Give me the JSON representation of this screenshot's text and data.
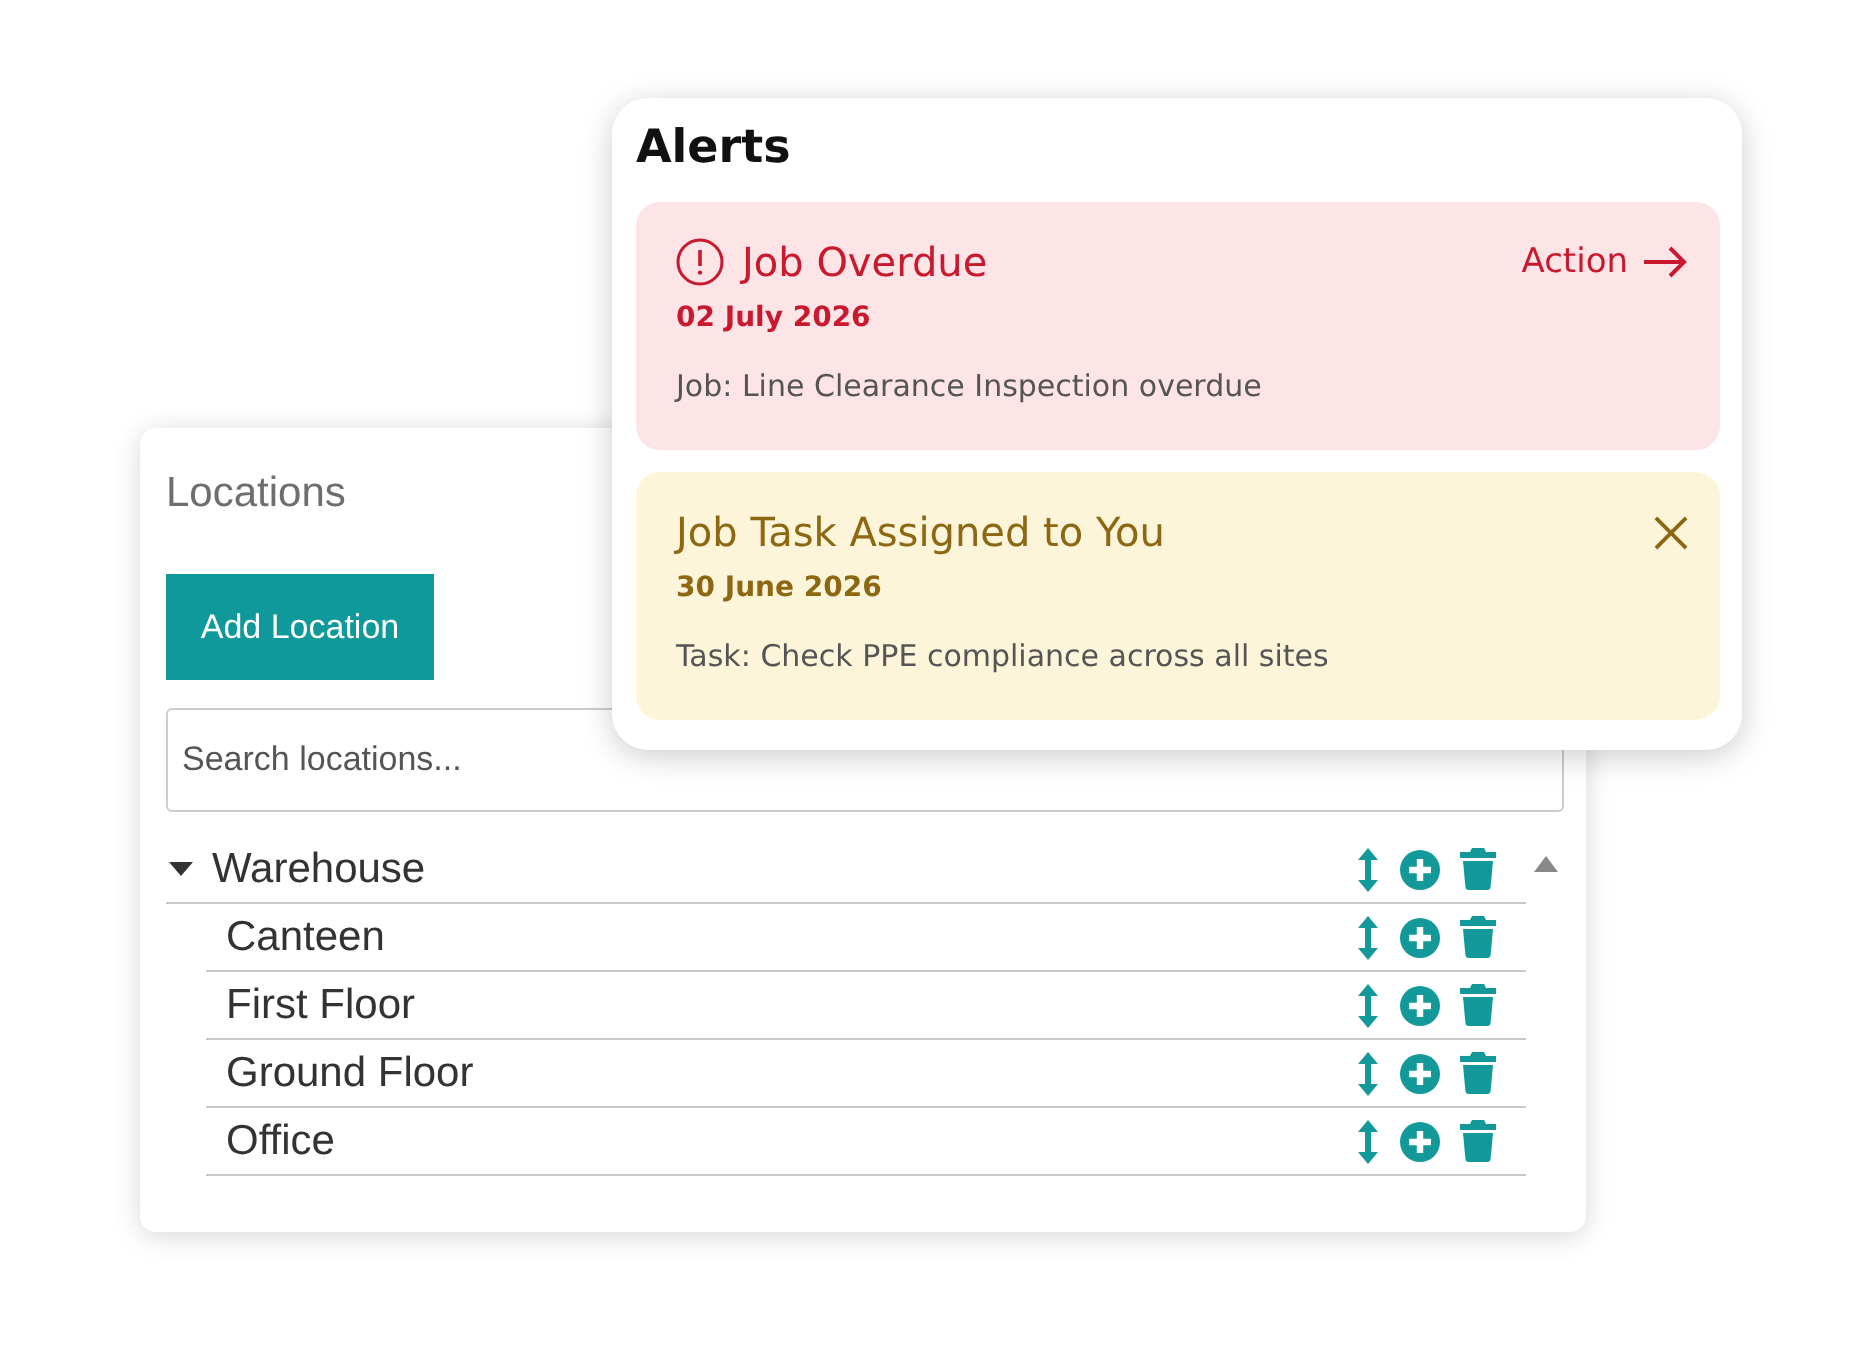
{
  "locations_panel": {
    "title": "Locations",
    "add_button": "Add Location",
    "search": {
      "placeholder": "Search locations..."
    },
    "tree": [
      {
        "label": "Warehouse",
        "expanded": true,
        "children": [
          {
            "label": "Canteen"
          },
          {
            "label": "First Floor"
          },
          {
            "label": "Ground Floor"
          },
          {
            "label": "Office"
          }
        ]
      }
    ]
  },
  "alerts_panel": {
    "title": "Alerts",
    "alerts": [
      {
        "kind": "error",
        "title": "Job Overdue",
        "date": "02 July 2026",
        "text": "Job: Line Clearance Inspection overdue",
        "action": "Action",
        "dismissible": false
      },
      {
        "kind": "warning",
        "title": "Job Task Assigned to You",
        "date": "30 June 2026",
        "text": "Task: Check PPE compliance across all sites",
        "dismissible": true
      }
    ]
  }
}
